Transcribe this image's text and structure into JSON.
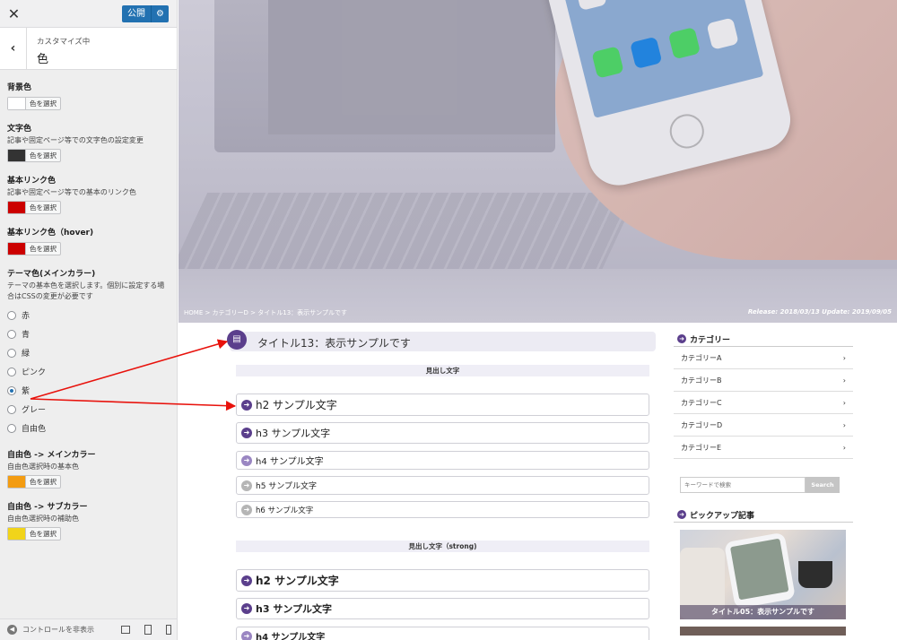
{
  "customizer": {
    "publish_label": "公開",
    "header_sub": "カスタマイズ中",
    "header_title": "色",
    "controls": {
      "bg": {
        "label": "背景色",
        "button": "色を選択",
        "color": "#ffffff"
      },
      "text": {
        "label": "文字色",
        "desc": "記事や固定ページ等での文字色の設定変更",
        "button": "色を選択",
        "color": "#333333"
      },
      "link": {
        "label": "基本リンク色",
        "desc": "記事や固定ページ等での基本のリンク色",
        "button": "色を選択",
        "color": "#cc0000"
      },
      "link_hover": {
        "label": "基本リンク色（hover)",
        "button": "色を選択",
        "color": "#cc0000"
      },
      "theme": {
        "label": "テーマ色(メインカラー)",
        "desc": "テーマの基本色を選択します。個別に設定する場合はCSSの変更が必要です",
        "options": [
          "赤",
          "青",
          "緑",
          "ピンク",
          "紫",
          "グレー",
          "自由色"
        ],
        "selected": "紫"
      },
      "free_main": {
        "label": "自由色 -> メインカラー",
        "desc": "自由色選択時の基本色",
        "button": "色を選択",
        "color": "#f39c12"
      },
      "free_sub": {
        "label": "自由色 -> サブカラー",
        "desc": "自由色選択時の補助色",
        "button": "色を選択",
        "color": "#f1d41a"
      }
    },
    "footer_label": "コントロールを非表示"
  },
  "preview": {
    "breadcrumb": "HOME > カテゴリーD > タイトル13：表示サンプルです",
    "release": "Release: 2018/03/13 Update: 2019/09/05",
    "article_title": "タイトル13：表示サンプルです",
    "section1": "見出し文字",
    "section2": "見出し文字（strong)",
    "headings": {
      "h2": "h2 サンプル文字",
      "h3": "h3 サンプル文字",
      "h4": "h4 サンプル文字",
      "h5": "h5 サンプル文字",
      "h6": "h6 サンプル文字"
    }
  },
  "sidebar": {
    "category_title": "カテゴリー",
    "categories": [
      "カテゴリーA",
      "カテゴリーB",
      "カテゴリーC",
      "カテゴリーD",
      "カテゴリーE"
    ],
    "search_placeholder": "キーワードで検索",
    "search_button": "Search",
    "pickup_title": "ピックアップ記事",
    "pickup_card_title": "タイトル05：表示サンプルです"
  },
  "colors": {
    "accent": "#5b3f8c",
    "wp_blue": "#2271b1",
    "annotation_arrow": "#e8120c"
  },
  "icons": {
    "close": "close-icon",
    "back": "chevron-left-icon",
    "settings": "gear-icon",
    "document": "document-icon",
    "arrow": "arrow-right-icon"
  }
}
